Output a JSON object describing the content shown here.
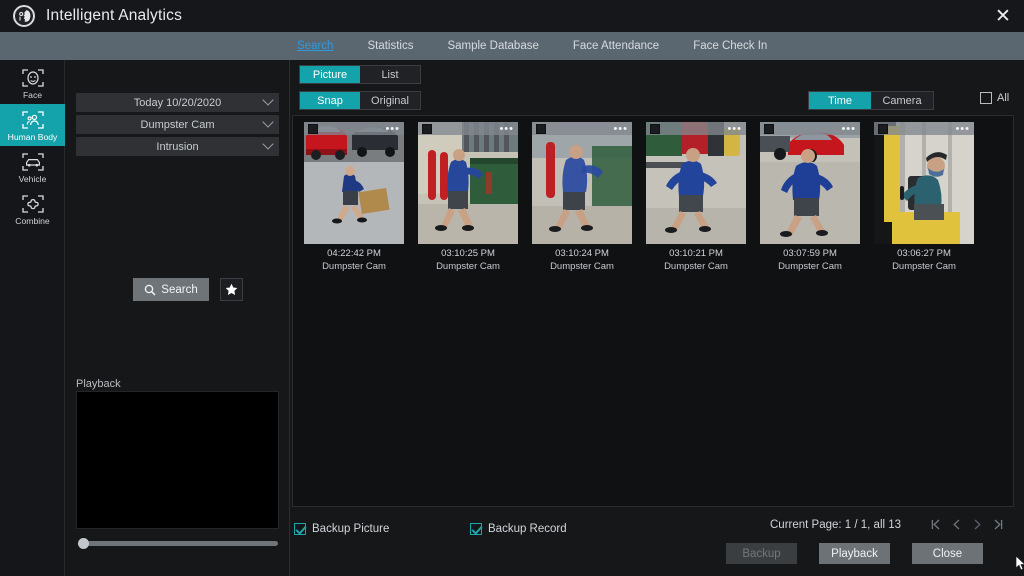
{
  "window": {
    "title": "Intelligent Analytics",
    "logo_icon": "face-analytics-logo",
    "close_icon": "close-icon"
  },
  "tabs": [
    {
      "label": "Search",
      "active": true
    },
    {
      "label": "Statistics",
      "active": false
    },
    {
      "label": "Sample Database",
      "active": false
    },
    {
      "label": "Face Attendance",
      "active": false
    },
    {
      "label": "Face Check In",
      "active": false
    }
  ],
  "sidebar": {
    "items": [
      {
        "label": "Face",
        "icon": "face-detect-icon",
        "active": false
      },
      {
        "label": "Human Body",
        "icon": "human-body-icon",
        "active": true
      },
      {
        "label": "Vehicle",
        "icon": "vehicle-icon",
        "active": false
      },
      {
        "label": "Combine",
        "icon": "combine-icon",
        "active": false
      }
    ]
  },
  "filters": {
    "dropdowns": [
      {
        "name": "date-range",
        "value": "Today 10/20/2020"
      },
      {
        "name": "camera",
        "value": "Dumpster Cam"
      },
      {
        "name": "event-type",
        "value": "Intrusion"
      }
    ],
    "search_label": "Search",
    "search_icon": "magnifier-icon",
    "favorite_icon": "star-icon"
  },
  "playback": {
    "label": "Playback",
    "slider_position_pct": 0
  },
  "view_toggles": {
    "display_mode": {
      "options": [
        "Picture",
        "List"
      ],
      "selected": "Picture"
    },
    "image_mode": {
      "options": [
        "Snap",
        "Original"
      ],
      "selected": "Snap"
    },
    "sort_mode": {
      "options": [
        "Time",
        "Camera"
      ],
      "selected": "Time"
    },
    "select_all": {
      "label": "All",
      "checked": false
    }
  },
  "results": [
    {
      "time": "04:22:42 PM",
      "camera": "Dumpster Cam",
      "selected": false
    },
    {
      "time": "03:10:25 PM",
      "camera": "Dumpster Cam",
      "selected": false
    },
    {
      "time": "03:10:24 PM",
      "camera": "Dumpster Cam",
      "selected": false
    },
    {
      "time": "03:10:21 PM",
      "camera": "Dumpster Cam",
      "selected": false
    },
    {
      "time": "03:07:59 PM",
      "camera": "Dumpster Cam",
      "selected": false
    },
    {
      "time": "03:06:27 PM",
      "camera": "Dumpster Cam",
      "selected": false
    }
  ],
  "footer": {
    "backup_picture": {
      "label": "Backup Picture",
      "checked": true
    },
    "backup_record": {
      "label": "Backup Record",
      "checked": true
    },
    "page_info": "Current Page: 1 / 1, all 13",
    "nav": {
      "first": "first-page-icon",
      "prev": "prev-page-icon",
      "next": "next-page-icon",
      "last": "last-page-icon"
    },
    "buttons": [
      {
        "label": "Backup",
        "disabled": true
      },
      {
        "label": "Playback",
        "disabled": false
      },
      {
        "label": "Close",
        "disabled": false
      }
    ]
  },
  "colors": {
    "accent_teal": "#14a3ab",
    "tabbar": "#5b6770",
    "active_tab_text": "#2f9bde",
    "background": "#161719"
  }
}
